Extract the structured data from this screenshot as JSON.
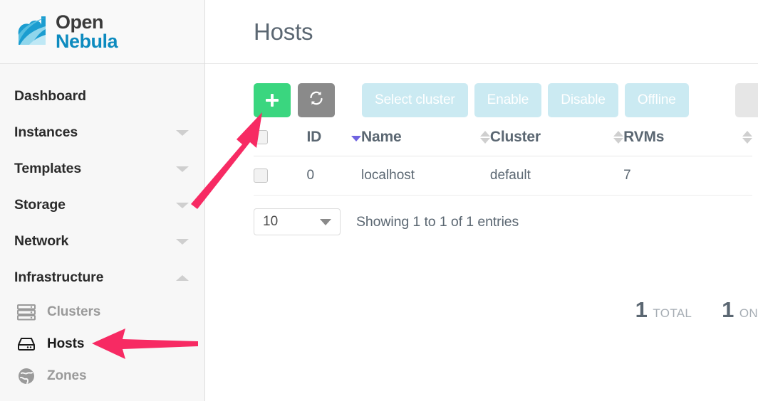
{
  "brand": {
    "name_line1": "Open",
    "name_line2": "Nebula",
    "logo_icon": "cloud-wave-logo",
    "color_dark": "#3b3b3b",
    "color_blue": "#0d8bbf"
  },
  "sidebar": {
    "items": [
      {
        "label": "Dashboard",
        "icon": "none",
        "expandable": false
      },
      {
        "label": "Instances",
        "icon": "chevron-down-icon",
        "expandable": true
      },
      {
        "label": "Templates",
        "icon": "chevron-down-icon",
        "expandable": true
      },
      {
        "label": "Storage",
        "icon": "chevron-down-icon",
        "expandable": true
      },
      {
        "label": "Network",
        "icon": "chevron-down-icon",
        "expandable": true
      },
      {
        "label": "Infrastructure",
        "icon": "chevron-up-icon",
        "expandable": true,
        "expanded": true
      }
    ],
    "sub_items": [
      {
        "label": "Clusters",
        "icon": "clusters-icon",
        "active": false
      },
      {
        "label": "Hosts",
        "icon": "host-server-icon",
        "active": true
      },
      {
        "label": "Zones",
        "icon": "globe-icon",
        "active": false
      }
    ]
  },
  "header": {
    "title": "Hosts"
  },
  "toolbar": {
    "add_label": "+",
    "add_icon": "plus-icon",
    "add_color": "#3ad67f",
    "refresh_icon": "refresh-icon",
    "refresh_color": "#8a8a8a",
    "buttons": [
      {
        "label": "Select cluster",
        "disabled": true
      },
      {
        "label": "Enable",
        "disabled": true
      },
      {
        "label": "Disable",
        "disabled": true
      },
      {
        "label": "Offline",
        "disabled": true
      }
    ],
    "disabled_color": "#cbeaf2",
    "edge_button_icon": "search-icon"
  },
  "table": {
    "columns": [
      {
        "label": "",
        "name": "select",
        "sort": "none"
      },
      {
        "label": "ID",
        "name": "id",
        "sort": "desc"
      },
      {
        "label": "Name",
        "name": "name",
        "sort": "both"
      },
      {
        "label": "Cluster",
        "name": "cluster",
        "sort": "both"
      },
      {
        "label": "RVMs",
        "name": "rvms",
        "sort": "both"
      }
    ],
    "rows": [
      {
        "id": "0",
        "name": "localhost",
        "cluster": "default",
        "rvms": "7"
      }
    ],
    "sort_active_color": "#6f63e0"
  },
  "footer": {
    "page_length": "10",
    "showing_text": "Showing 1 to 1 of 1 entries"
  },
  "stats": [
    {
      "value": "1",
      "label": "TOTAL"
    },
    {
      "value": "1",
      "label": "ON"
    }
  ],
  "annotations": {
    "color": "#f72a63",
    "arrows": [
      {
        "name": "arrow-to-add-button",
        "points_at": "add-host-button"
      },
      {
        "name": "arrow-to-hosts-menu",
        "points_at": "sidebar-item-hosts"
      }
    ]
  }
}
